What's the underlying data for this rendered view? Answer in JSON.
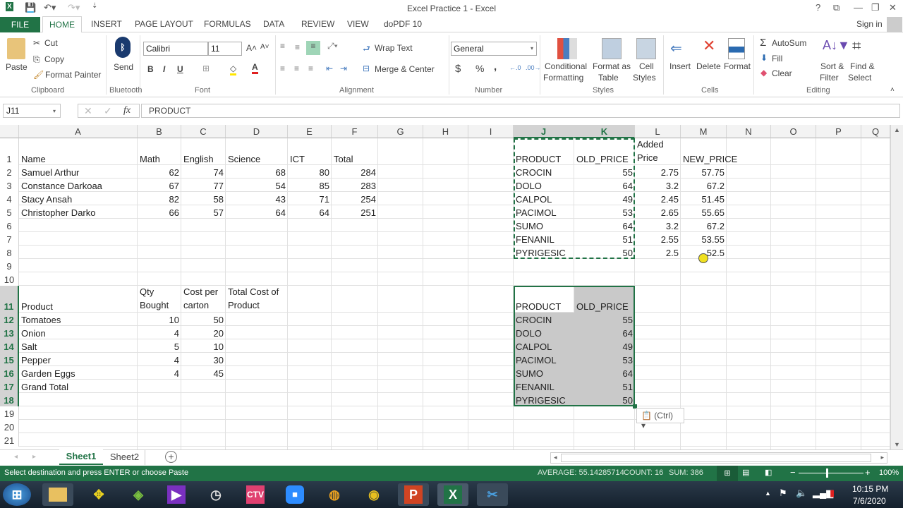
{
  "window": {
    "title": "Excel Practice 1 - Excel",
    "controls": [
      "?",
      "⧉",
      "—",
      "❐",
      "✕"
    ],
    "sign_in": "Sign in"
  },
  "tabs": [
    "FILE",
    "HOME",
    "INSERT",
    "PAGE LAYOUT",
    "FORMULAS",
    "DATA",
    "REVIEW",
    "VIEW",
    "doPDF 10"
  ],
  "ribbon": {
    "clipboard": {
      "paste": "Paste",
      "cut": "Cut",
      "copy": "Copy",
      "format_painter": "Format Painter",
      "label": "Clipboard"
    },
    "bluetooth": {
      "send": "Send",
      "label": "Bluetooth"
    },
    "font": {
      "name": "Calibri",
      "size": "11",
      "bold": "B",
      "italic": "I",
      "underline": "U",
      "label": "Font"
    },
    "alignment": {
      "wrap_text": "Wrap Text",
      "merge_center": "Merge & Center",
      "label": "Alignment"
    },
    "number": {
      "format": "General",
      "currency": "$",
      "percent": "%",
      "comma": ",",
      "label": "Number"
    },
    "styles": {
      "conditional": "Conditional",
      "conditional2": "Formatting",
      "format_table": "Format as",
      "format_table2": "Table",
      "cell_styles": "Cell",
      "cell_styles2": "Styles",
      "label": "Styles"
    },
    "cells": {
      "insert": "Insert",
      "delete": "Delete",
      "format": "Format",
      "label": "Cells"
    },
    "editing": {
      "autosum": "AutoSum",
      "fill": "Fill",
      "clear": "Clear",
      "sort": "Sort &",
      "sort2": "Filter",
      "find": "Find &",
      "find2": "Select",
      "label": "Editing"
    }
  },
  "formula_bar": {
    "name_box": "J11",
    "value": "PRODUCT"
  },
  "columns": [
    "A",
    "B",
    "C",
    "D",
    "E",
    "F",
    "G",
    "H",
    "I",
    "J",
    "K",
    "L",
    "M",
    "N",
    "O",
    "P",
    "Q"
  ],
  "rows": [
    "1",
    "2",
    "3",
    "4",
    "5",
    "6",
    "7",
    "8",
    "9",
    "10",
    "11",
    "12",
    "13",
    "14",
    "15",
    "16",
    "17",
    "18",
    "19",
    "20",
    "21"
  ],
  "students": {
    "headers": [
      "Name",
      "Math",
      "English",
      "Science",
      "ICT",
      "Total"
    ],
    "rows": [
      [
        "Samuel Arthur",
        "62",
        "74",
        "68",
        "80",
        "284"
      ],
      [
        "Constance Darkoaa",
        "67",
        "77",
        "54",
        "85",
        "283"
      ],
      [
        "Stacy Ansah",
        "82",
        "58",
        "43",
        "71",
        "254"
      ],
      [
        "Christopher Darko",
        "66",
        "57",
        "64",
        "64",
        "251"
      ]
    ]
  },
  "prices": {
    "headers": [
      "PRODUCT",
      "OLD_PRICE",
      "Added Price",
      "NEW_PRICE"
    ],
    "rows": [
      [
        "CROCIN",
        "55",
        "2.75",
        "57.75"
      ],
      [
        "DOLO",
        "64",
        "3.2",
        "67.2"
      ],
      [
        "CALPOL",
        "49",
        "2.45",
        "51.45"
      ],
      [
        "PACIMOL",
        "53",
        "2.65",
        "55.65"
      ],
      [
        "SUMO",
        "64",
        "3.2",
        "67.2"
      ],
      [
        "FENANIL",
        "51",
        "2.55",
        "53.55"
      ],
      [
        "PYRIGESIC",
        "50",
        "2.5",
        "52.5"
      ]
    ]
  },
  "groceries": {
    "headers": [
      "Product",
      "Qty Bought",
      "Cost per carton",
      "Total Cost of Product"
    ],
    "rows": [
      [
        "Tomatoes",
        "10",
        "50"
      ],
      [
        "Onion",
        "4",
        "20"
      ],
      [
        "Salt",
        "5",
        "10"
      ],
      [
        "Pepper",
        "4",
        "30"
      ],
      [
        "Garden Eggs",
        "4",
        "45"
      ]
    ],
    "grand_total": "Grand Total"
  },
  "pasted": {
    "headers": [
      "PRODUCT",
      "OLD_PRICE"
    ],
    "rows": [
      [
        "CROCIN",
        "55"
      ],
      [
        "DOLO",
        "64"
      ],
      [
        "CALPOL",
        "49"
      ],
      [
        "PACIMOL",
        "53"
      ],
      [
        "SUMO",
        "64"
      ],
      [
        "FENANIL",
        "51"
      ],
      [
        "PYRIGESIC",
        "50"
      ]
    ],
    "paste_options": "(Ctrl)"
  },
  "sheets": [
    "Sheet1",
    "Sheet2"
  ],
  "status": {
    "message": "Select destination and press ENTER or choose Paste",
    "average": "AVERAGE: 55.14285714",
    "count": "COUNT: 16",
    "sum": "SUM: 386",
    "zoom": "100%"
  },
  "taskbar": {
    "time": "10:15 PM",
    "date": "7/6/2020"
  }
}
